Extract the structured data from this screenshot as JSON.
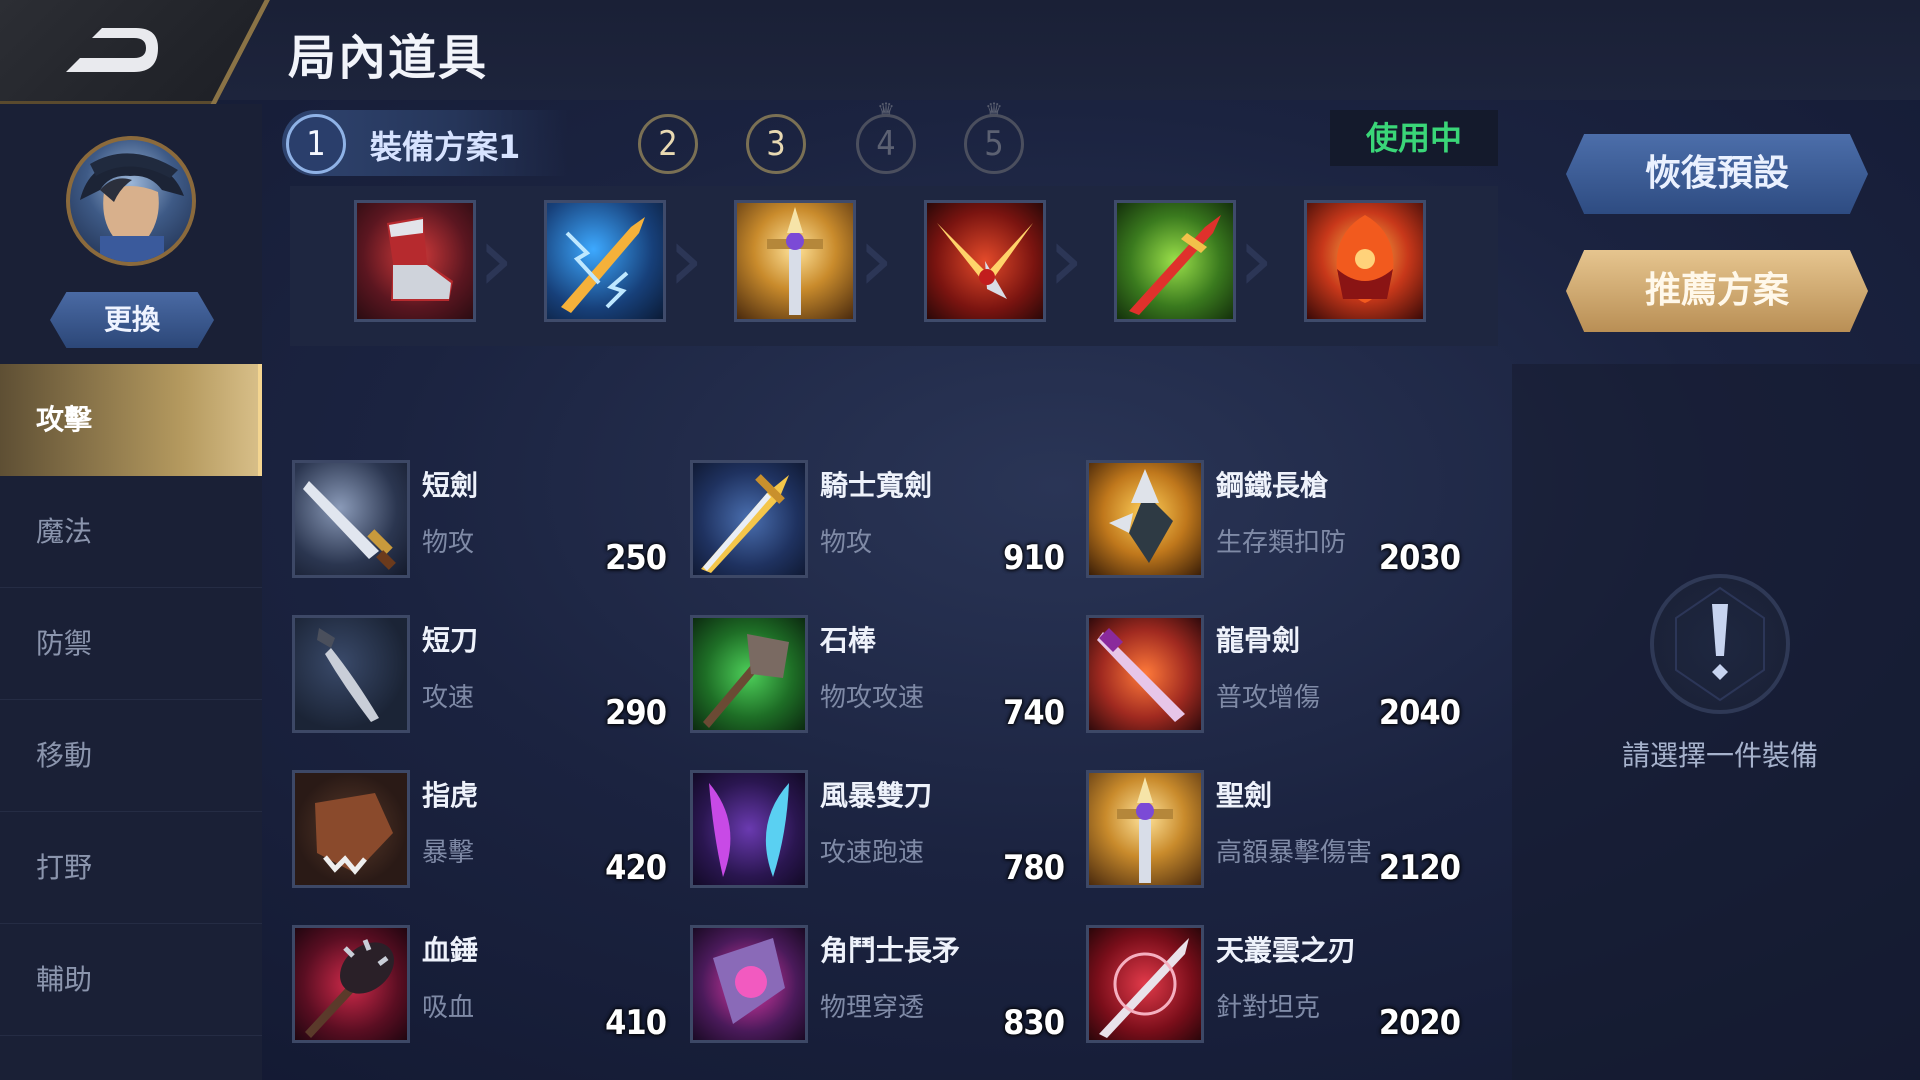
{
  "header": {
    "title": "局內道具"
  },
  "hero": {
    "change_label": "更換"
  },
  "categories": [
    {
      "label": "攻擊",
      "active": true
    },
    {
      "label": "魔法",
      "active": false
    },
    {
      "label": "防禦",
      "active": false
    },
    {
      "label": "移動",
      "active": false
    },
    {
      "label": "打野",
      "active": false
    },
    {
      "label": "輔助",
      "active": false
    }
  ],
  "plans": {
    "active_label": "裝備方案1",
    "numbers": [
      "1",
      "2",
      "3",
      "4",
      "5"
    ],
    "locked": [
      "4",
      "5"
    ],
    "status": "使用中"
  },
  "equipped_slots": [
    {
      "icon": "boots-icon"
    },
    {
      "icon": "lightning-blade-icon"
    },
    {
      "icon": "holy-sword-icon"
    },
    {
      "icon": "winged-blade-icon"
    },
    {
      "icon": "green-blade-icon"
    },
    {
      "icon": "fire-crest-icon"
    }
  ],
  "actions": {
    "restore_label": "恢復預設",
    "recommend_label": "推薦方案"
  },
  "hint": {
    "text": "請選擇一件裝備"
  },
  "items": [
    {
      "name": "短劍",
      "desc": "物攻",
      "price": "250",
      "icon": "short-sword-icon"
    },
    {
      "name": "騎士寬劍",
      "desc": "物攻",
      "price": "910",
      "icon": "knight-broadsword-icon"
    },
    {
      "name": "鋼鐵長槍",
      "desc": "生存類扣防",
      "price": "2030",
      "icon": "steel-spear-icon"
    },
    {
      "name": "短刀",
      "desc": "攻速",
      "price": "290",
      "icon": "dagger-icon"
    },
    {
      "name": "石棒",
      "desc": "物攻攻速",
      "price": "740",
      "icon": "stone-club-icon"
    },
    {
      "name": "龍骨劍",
      "desc": "普攻增傷",
      "price": "2040",
      "icon": "dragonbone-sword-icon"
    },
    {
      "name": "指虎",
      "desc": "暴擊",
      "price": "420",
      "icon": "knuckles-icon"
    },
    {
      "name": "風暴雙刀",
      "desc": "攻速跑速",
      "price": "780",
      "icon": "storm-blades-icon"
    },
    {
      "name": "聖劍",
      "desc": "高額暴擊傷害",
      "price": "2120",
      "icon": "holy-sword-icon"
    },
    {
      "name": "血錘",
      "desc": "吸血",
      "price": "410",
      "icon": "blood-hammer-icon"
    },
    {
      "name": "角鬥士長矛",
      "desc": "物理穿透",
      "price": "830",
      "icon": "gladiator-spear-icon"
    },
    {
      "name": "天叢雲之刃",
      "desc": "針對坦克",
      "price": "2020",
      "icon": "murakumo-blade-icon"
    }
  ],
  "colors": {
    "accent_gold": "#d9c08a",
    "active_green": "#3ad678",
    "panel_blue": "#2e4c82"
  }
}
